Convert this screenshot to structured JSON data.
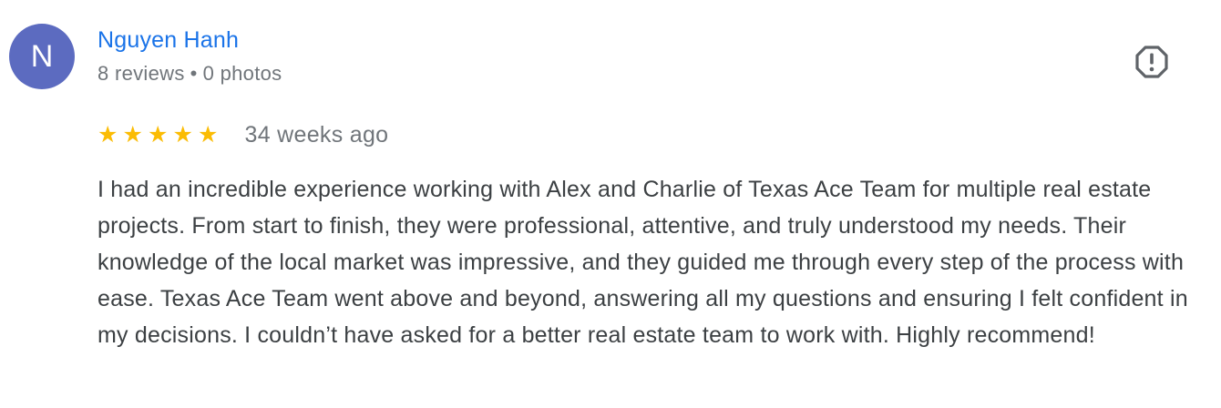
{
  "reviewer": {
    "initial": "N",
    "name": "Nguyen Hanh",
    "reviews": "8 reviews",
    "separator": "•",
    "photos": "0 photos",
    "avatar_color": "#5c6bc0"
  },
  "report": {
    "icon": "report-flag-icon"
  },
  "review": {
    "rating": 5,
    "max_rating": 5,
    "star_color": "#fbbc04",
    "date": "34 weeks ago",
    "text": "I had an incredible experience working with Alex and Charlie of Texas Ace Team for multiple real estate projects. From start to finish, they were professional, attentive, and truly understood my needs. Their knowledge of the local market was impressive, and they guided me through every step of the process with ease. Texas Ace Team went above and beyond, answering all my questions and ensuring I felt confident in my decisions. I couldn’t have asked for a better real estate team to work with. Highly recommend!"
  },
  "colors": {
    "name_link": "#1a73e8",
    "meta_text": "#70757a",
    "body_text": "#3c4043"
  }
}
